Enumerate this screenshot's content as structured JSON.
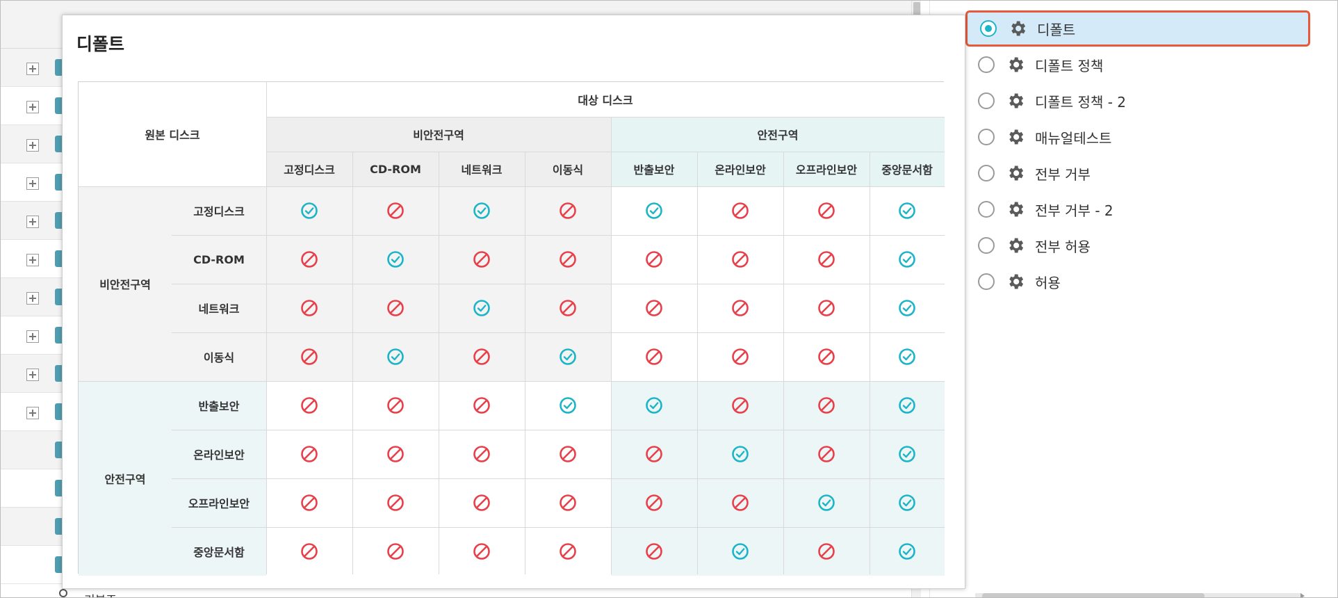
{
  "background_list": {
    "bottom_label": "기본조"
  },
  "right_panel": {
    "policies": [
      {
        "label": "디폴트",
        "selected": true
      },
      {
        "label": "디폴트 정책",
        "selected": false
      },
      {
        "label": "디폴트 정책 - 2",
        "selected": false
      },
      {
        "label": "매뉴얼테스트",
        "selected": false
      },
      {
        "label": "전부 거부",
        "selected": false
      },
      {
        "label": "전부 거부 - 2",
        "selected": false
      },
      {
        "label": "전부 허용",
        "selected": false
      },
      {
        "label": "허용",
        "selected": false
      }
    ]
  },
  "popup": {
    "title": "디폴트",
    "source_header": "원본 디스크",
    "target_header": "대상 디스크",
    "zones": [
      "비안전구역",
      "안전구역"
    ],
    "disks": [
      "고정디스크",
      "CD-ROM",
      "네트워크",
      "이동식",
      "반출보안",
      "온라인보안",
      "오프라인보안",
      "중앙문서함"
    ],
    "matrix": [
      [
        "allow",
        "deny",
        "allow",
        "deny",
        "allow",
        "deny",
        "deny",
        "allow"
      ],
      [
        "deny",
        "allow",
        "deny",
        "deny",
        "deny",
        "deny",
        "deny",
        "allow"
      ],
      [
        "deny",
        "deny",
        "allow",
        "deny",
        "deny",
        "deny",
        "deny",
        "allow"
      ],
      [
        "deny",
        "allow",
        "deny",
        "allow",
        "deny",
        "deny",
        "deny",
        "allow"
      ],
      [
        "deny",
        "deny",
        "deny",
        "allow",
        "allow",
        "deny",
        "deny",
        "allow"
      ],
      [
        "deny",
        "deny",
        "deny",
        "deny",
        "deny",
        "allow",
        "deny",
        "allow"
      ],
      [
        "deny",
        "deny",
        "deny",
        "deny",
        "deny",
        "deny",
        "allow",
        "allow"
      ],
      [
        "deny",
        "deny",
        "deny",
        "deny",
        "deny",
        "allow",
        "deny",
        "allow"
      ]
    ],
    "icons": {
      "allow": "check-circle-icon",
      "deny": "prohibited-icon"
    },
    "colors": {
      "allow": "#1bb5c7",
      "deny": "#e8404a",
      "selection_border": "#e8593b"
    }
  }
}
